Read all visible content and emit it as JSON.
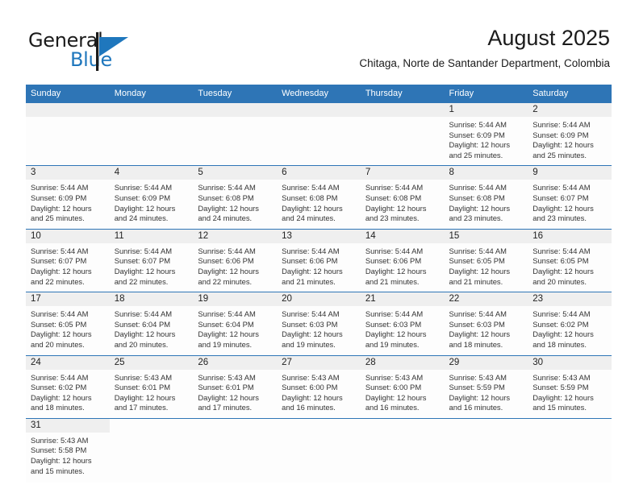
{
  "brand": {
    "name_part1": "General",
    "name_part2": "Blue",
    "flag_icon": "blue-triangle-flag-icon",
    "accent_color": "#1f77bd"
  },
  "header": {
    "month_title": "August 2025",
    "location": "Chitaga, Norte de Santander Department, Colombia"
  },
  "theme": {
    "header_blue": "#2e75b6",
    "daynum_band": "#efefef",
    "cell_background": "#fdfdfd"
  },
  "calendar": {
    "weekdays": [
      "Sunday",
      "Monday",
      "Tuesday",
      "Wednesday",
      "Thursday",
      "Friday",
      "Saturday"
    ],
    "weeks": [
      [
        {
          "day": "",
          "empty": true,
          "sunrise": "",
          "sunset": "",
          "daylight1": "",
          "daylight2": ""
        },
        {
          "day": "",
          "empty": true,
          "sunrise": "",
          "sunset": "",
          "daylight1": "",
          "daylight2": ""
        },
        {
          "day": "",
          "empty": true,
          "sunrise": "",
          "sunset": "",
          "daylight1": "",
          "daylight2": ""
        },
        {
          "day": "",
          "empty": true,
          "sunrise": "",
          "sunset": "",
          "daylight1": "",
          "daylight2": ""
        },
        {
          "day": "",
          "empty": true,
          "sunrise": "",
          "sunset": "",
          "daylight1": "",
          "daylight2": ""
        },
        {
          "day": "1",
          "sunrise": "Sunrise: 5:44 AM",
          "sunset": "Sunset: 6:09 PM",
          "daylight1": "Daylight: 12 hours",
          "daylight2": "and 25 minutes."
        },
        {
          "day": "2",
          "sunrise": "Sunrise: 5:44 AM",
          "sunset": "Sunset: 6:09 PM",
          "daylight1": "Daylight: 12 hours",
          "daylight2": "and 25 minutes."
        }
      ],
      [
        {
          "day": "3",
          "sunrise": "Sunrise: 5:44 AM",
          "sunset": "Sunset: 6:09 PM",
          "daylight1": "Daylight: 12 hours",
          "daylight2": "and 25 minutes."
        },
        {
          "day": "4",
          "sunrise": "Sunrise: 5:44 AM",
          "sunset": "Sunset: 6:09 PM",
          "daylight1": "Daylight: 12 hours",
          "daylight2": "and 24 minutes."
        },
        {
          "day": "5",
          "sunrise": "Sunrise: 5:44 AM",
          "sunset": "Sunset: 6:08 PM",
          "daylight1": "Daylight: 12 hours",
          "daylight2": "and 24 minutes."
        },
        {
          "day": "6",
          "sunrise": "Sunrise: 5:44 AM",
          "sunset": "Sunset: 6:08 PM",
          "daylight1": "Daylight: 12 hours",
          "daylight2": "and 24 minutes."
        },
        {
          "day": "7",
          "sunrise": "Sunrise: 5:44 AM",
          "sunset": "Sunset: 6:08 PM",
          "daylight1": "Daylight: 12 hours",
          "daylight2": "and 23 minutes."
        },
        {
          "day": "8",
          "sunrise": "Sunrise: 5:44 AM",
          "sunset": "Sunset: 6:08 PM",
          "daylight1": "Daylight: 12 hours",
          "daylight2": "and 23 minutes."
        },
        {
          "day": "9",
          "sunrise": "Sunrise: 5:44 AM",
          "sunset": "Sunset: 6:07 PM",
          "daylight1": "Daylight: 12 hours",
          "daylight2": "and 23 minutes."
        }
      ],
      [
        {
          "day": "10",
          "sunrise": "Sunrise: 5:44 AM",
          "sunset": "Sunset: 6:07 PM",
          "daylight1": "Daylight: 12 hours",
          "daylight2": "and 22 minutes."
        },
        {
          "day": "11",
          "sunrise": "Sunrise: 5:44 AM",
          "sunset": "Sunset: 6:07 PM",
          "daylight1": "Daylight: 12 hours",
          "daylight2": "and 22 minutes."
        },
        {
          "day": "12",
          "sunrise": "Sunrise: 5:44 AM",
          "sunset": "Sunset: 6:06 PM",
          "daylight1": "Daylight: 12 hours",
          "daylight2": "and 22 minutes."
        },
        {
          "day": "13",
          "sunrise": "Sunrise: 5:44 AM",
          "sunset": "Sunset: 6:06 PM",
          "daylight1": "Daylight: 12 hours",
          "daylight2": "and 21 minutes."
        },
        {
          "day": "14",
          "sunrise": "Sunrise: 5:44 AM",
          "sunset": "Sunset: 6:06 PM",
          "daylight1": "Daylight: 12 hours",
          "daylight2": "and 21 minutes."
        },
        {
          "day": "15",
          "sunrise": "Sunrise: 5:44 AM",
          "sunset": "Sunset: 6:05 PM",
          "daylight1": "Daylight: 12 hours",
          "daylight2": "and 21 minutes."
        },
        {
          "day": "16",
          "sunrise": "Sunrise: 5:44 AM",
          "sunset": "Sunset: 6:05 PM",
          "daylight1": "Daylight: 12 hours",
          "daylight2": "and 20 minutes."
        }
      ],
      [
        {
          "day": "17",
          "sunrise": "Sunrise: 5:44 AM",
          "sunset": "Sunset: 6:05 PM",
          "daylight1": "Daylight: 12 hours",
          "daylight2": "and 20 minutes."
        },
        {
          "day": "18",
          "sunrise": "Sunrise: 5:44 AM",
          "sunset": "Sunset: 6:04 PM",
          "daylight1": "Daylight: 12 hours",
          "daylight2": "and 20 minutes."
        },
        {
          "day": "19",
          "sunrise": "Sunrise: 5:44 AM",
          "sunset": "Sunset: 6:04 PM",
          "daylight1": "Daylight: 12 hours",
          "daylight2": "and 19 minutes."
        },
        {
          "day": "20",
          "sunrise": "Sunrise: 5:44 AM",
          "sunset": "Sunset: 6:03 PM",
          "daylight1": "Daylight: 12 hours",
          "daylight2": "and 19 minutes."
        },
        {
          "day": "21",
          "sunrise": "Sunrise: 5:44 AM",
          "sunset": "Sunset: 6:03 PM",
          "daylight1": "Daylight: 12 hours",
          "daylight2": "and 19 minutes."
        },
        {
          "day": "22",
          "sunrise": "Sunrise: 5:44 AM",
          "sunset": "Sunset: 6:03 PM",
          "daylight1": "Daylight: 12 hours",
          "daylight2": "and 18 minutes."
        },
        {
          "day": "23",
          "sunrise": "Sunrise: 5:44 AM",
          "sunset": "Sunset: 6:02 PM",
          "daylight1": "Daylight: 12 hours",
          "daylight2": "and 18 minutes."
        }
      ],
      [
        {
          "day": "24",
          "sunrise": "Sunrise: 5:44 AM",
          "sunset": "Sunset: 6:02 PM",
          "daylight1": "Daylight: 12 hours",
          "daylight2": "and 18 minutes."
        },
        {
          "day": "25",
          "sunrise": "Sunrise: 5:43 AM",
          "sunset": "Sunset: 6:01 PM",
          "daylight1": "Daylight: 12 hours",
          "daylight2": "and 17 minutes."
        },
        {
          "day": "26",
          "sunrise": "Sunrise: 5:43 AM",
          "sunset": "Sunset: 6:01 PM",
          "daylight1": "Daylight: 12 hours",
          "daylight2": "and 17 minutes."
        },
        {
          "day": "27",
          "sunrise": "Sunrise: 5:43 AM",
          "sunset": "Sunset: 6:00 PM",
          "daylight1": "Daylight: 12 hours",
          "daylight2": "and 16 minutes."
        },
        {
          "day": "28",
          "sunrise": "Sunrise: 5:43 AM",
          "sunset": "Sunset: 6:00 PM",
          "daylight1": "Daylight: 12 hours",
          "daylight2": "and 16 minutes."
        },
        {
          "day": "29",
          "sunrise": "Sunrise: 5:43 AM",
          "sunset": "Sunset: 5:59 PM",
          "daylight1": "Daylight: 12 hours",
          "daylight2": "and 16 minutes."
        },
        {
          "day": "30",
          "sunrise": "Sunrise: 5:43 AM",
          "sunset": "Sunset: 5:59 PM",
          "daylight1": "Daylight: 12 hours",
          "daylight2": "and 15 minutes."
        }
      ],
      [
        {
          "day": "31",
          "sunrise": "Sunrise: 5:43 AM",
          "sunset": "Sunset: 5:58 PM",
          "daylight1": "Daylight: 12 hours",
          "daylight2": "and 15 minutes."
        },
        {
          "day": "",
          "blank": true,
          "sunrise": "",
          "sunset": "",
          "daylight1": "",
          "daylight2": ""
        },
        {
          "day": "",
          "blank": true,
          "sunrise": "",
          "sunset": "",
          "daylight1": "",
          "daylight2": ""
        },
        {
          "day": "",
          "blank": true,
          "sunrise": "",
          "sunset": "",
          "daylight1": "",
          "daylight2": ""
        },
        {
          "day": "",
          "blank": true,
          "sunrise": "",
          "sunset": "",
          "daylight1": "",
          "daylight2": ""
        },
        {
          "day": "",
          "blank": true,
          "sunrise": "",
          "sunset": "",
          "daylight1": "",
          "daylight2": ""
        },
        {
          "day": "",
          "blank": true,
          "sunrise": "",
          "sunset": "",
          "daylight1": "",
          "daylight2": ""
        }
      ]
    ]
  }
}
